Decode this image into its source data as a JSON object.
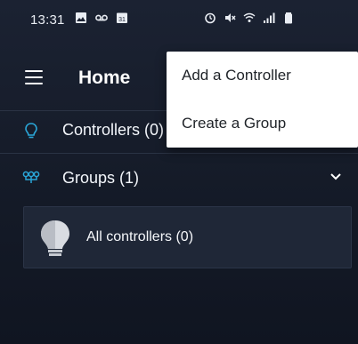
{
  "status_bar": {
    "time": "13:31",
    "left_icons": [
      "image-icon",
      "voicemail-icon",
      "calendar-icon"
    ],
    "calendar_day": "31",
    "right_icons": [
      "alarm-icon",
      "mute-icon",
      "wifi-icon",
      "signal-icon",
      "battery-icon"
    ]
  },
  "app_bar": {
    "title": "Home",
    "menu_icon": "hamburger-icon"
  },
  "list": {
    "controllers": {
      "label": "Controllers (0)",
      "icon": "lightbulb-outline-icon"
    },
    "groups": {
      "label": "Groups (1)",
      "icon": "group-tree-icon",
      "expanded_icon": "chevron-down-icon"
    }
  },
  "group_card": {
    "label": "All controllers (0)",
    "icon": "lightbulb-icon"
  },
  "overflow_menu": {
    "items": [
      "Add a Controller",
      "Create a Group"
    ]
  },
  "colors": {
    "background": "#151b28",
    "accent": "#2aa6d8",
    "menu_bg": "#ffffff"
  }
}
